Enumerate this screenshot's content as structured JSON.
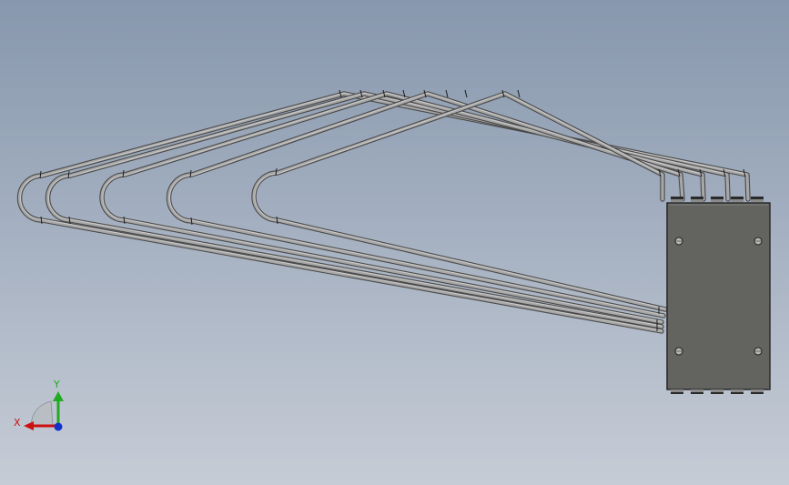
{
  "triad": {
    "x_label": "X",
    "y_label": "Y",
    "x_color": "#cc1111",
    "y_color": "#22aa22",
    "z_color": "#1133cc"
  },
  "icons": [
    "coordinate-triad-icon"
  ],
  "model": {
    "pipe_loop_count": 5,
    "mount_hole_count": 4,
    "body_color": "#636360",
    "pipe_color": "#9a9a9a"
  }
}
